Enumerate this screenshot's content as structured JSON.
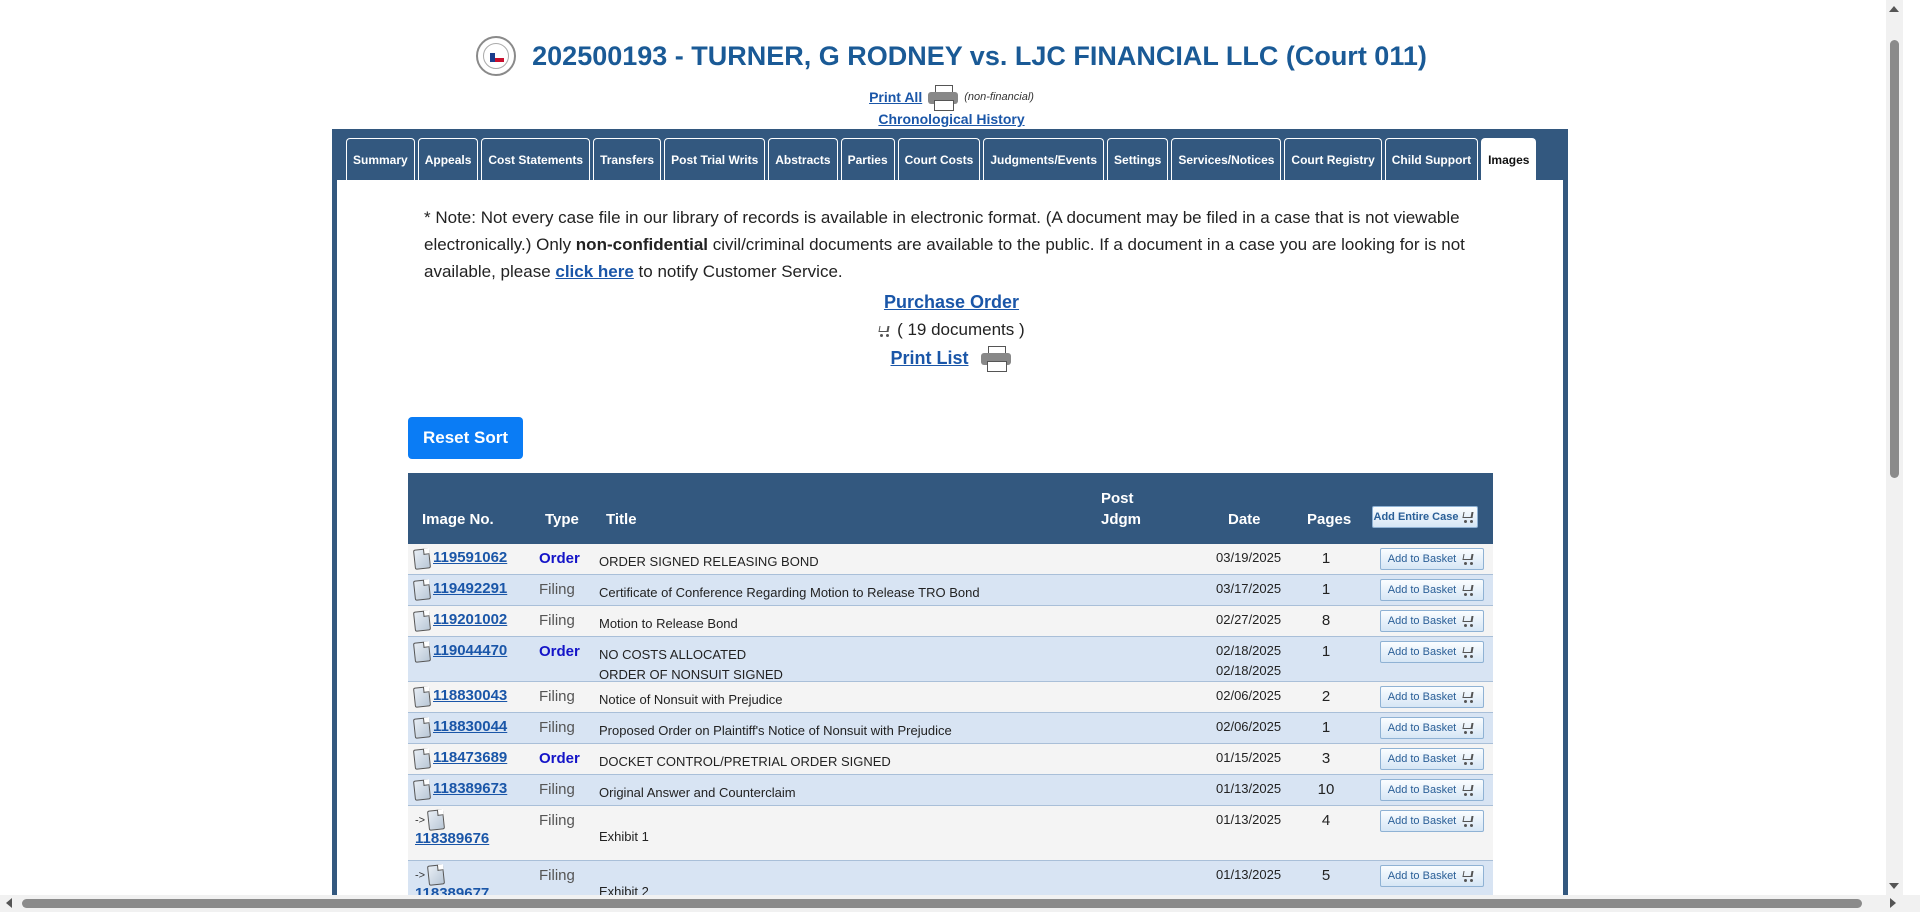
{
  "header": {
    "case_title": "202500193 - TURNER, G RODNEY vs. LJC FINANCIAL LLC (Court 011)",
    "print_all_label": "Print All",
    "non_financial": "(non-financial)",
    "chronological_label": "Chronological History"
  },
  "tabs": [
    {
      "label": "Summary"
    },
    {
      "label": "Appeals"
    },
    {
      "label": "Cost Statements"
    },
    {
      "label": "Transfers"
    },
    {
      "label": "Post Trial Writs"
    },
    {
      "label": "Abstracts"
    },
    {
      "label": "Parties"
    },
    {
      "label": "Court Costs"
    },
    {
      "label": "Judgments/Events"
    },
    {
      "label": "Settings"
    },
    {
      "label": "Services/Notices"
    },
    {
      "label": "Court Registry"
    },
    {
      "label": "Child Support"
    },
    {
      "label": "Images",
      "active": true
    }
  ],
  "note": {
    "part1": "* Note: Not every case file in our library of records is available in electronic format. (A document may be filed in a case that is not viewable electronically.) Only ",
    "bold": "non-confidential",
    "part2": " civil/criminal documents are available to the public. If a document in a case you are looking for is not available, please ",
    "link": "click here",
    "part3": " to notify Customer Service."
  },
  "purchase_order_label": "Purchase Order",
  "documents_count": "( 19 documents )",
  "print_list_label": "Print List",
  "reset_sort_label": "Reset Sort",
  "table": {
    "headers": {
      "image_no": "Image No.",
      "type": "Type",
      "title": "Title",
      "post": "Post",
      "jdgm": "Jdgm",
      "date": "Date",
      "pages": "Pages",
      "add_entire_case": "Add Entire Case"
    },
    "add_to_basket_label": "Add to Basket",
    "rows": [
      {
        "image": "119591062",
        "type": "Order",
        "titles": [
          "ORDER SIGNED RELEASING BOND"
        ],
        "dates": [
          "03/19/2025"
        ],
        "pages": "1"
      },
      {
        "image": "119492291",
        "type": "Filing",
        "titles": [
          "Certificate of Conference Regarding Motion to Release TRO Bond"
        ],
        "dates": [
          "03/17/2025"
        ],
        "pages": "1"
      },
      {
        "image": "119201002",
        "type": "Filing",
        "titles": [
          "Motion to Release Bond"
        ],
        "dates": [
          "02/27/2025"
        ],
        "pages": "8"
      },
      {
        "image": "119044470",
        "type": "Order",
        "titles": [
          "NO COSTS ALLOCATED",
          "ORDER OF NONSUIT SIGNED"
        ],
        "dates": [
          "02/18/2025",
          "02/18/2025"
        ],
        "pages": "1"
      },
      {
        "image": "118830043",
        "type": "Filing",
        "titles": [
          "Notice of Nonsuit with Prejudice"
        ],
        "dates": [
          "02/06/2025"
        ],
        "pages": "2"
      },
      {
        "image": "118830044",
        "type": "Filing",
        "titles": [
          "Proposed Order on Plaintiff's Notice of Nonsuit with Prejudice"
        ],
        "dates": [
          "02/06/2025"
        ],
        "pages": "1"
      },
      {
        "image": "118473689",
        "type": "Order",
        "titles": [
          "DOCKET CONTROL/PRETRIAL ORDER SIGNED"
        ],
        "dates": [
          "01/15/2025"
        ],
        "pages": "3"
      },
      {
        "image": "118389673",
        "type": "Filing",
        "titles": [
          "Original Answer and Counterclaim"
        ],
        "dates": [
          "01/13/2025"
        ],
        "pages": "10"
      },
      {
        "image": "118389676",
        "type": "Filing",
        "titles": [
          "Exhibit 1"
        ],
        "dates": [
          "01/13/2025"
        ],
        "pages": "4",
        "child": true
      },
      {
        "image": "118389677",
        "type": "Filing",
        "titles": [
          "Exhibit 2"
        ],
        "dates": [
          "01/13/2025"
        ],
        "pages": "5",
        "child": true
      }
    ]
  }
}
